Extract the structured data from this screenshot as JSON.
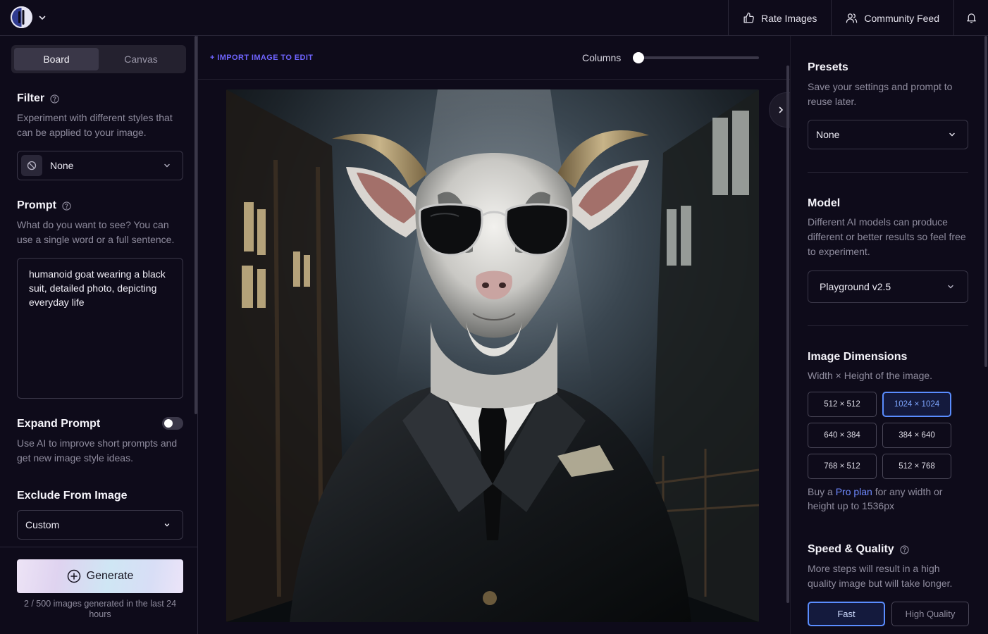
{
  "header": {
    "rate_label": "Rate Images",
    "feed_label": "Community Feed"
  },
  "left": {
    "tabs": [
      "Board",
      "Canvas"
    ],
    "active_tab": "Board",
    "filter": {
      "title": "Filter",
      "desc": "Experiment with different styles that can be applied to your image.",
      "value": "None"
    },
    "prompt": {
      "title": "Prompt",
      "desc": "What do you want to see? You can use a single word or a full sentence.",
      "value": "humanoid goat wearing a black suit, detailed photo, depicting everyday life"
    },
    "expand": {
      "title": "Expand Prompt",
      "desc": "Use AI to improve short prompts and get new image style ideas.",
      "enabled": false
    },
    "exclude": {
      "title": "Exclude From Image",
      "value": "Custom"
    },
    "generate_label": "Generate",
    "count_text": "2 / 500 images generated in the last 24 hours"
  },
  "center": {
    "import_label": "+ IMPORT IMAGE TO EDIT",
    "columns_label": "Columns",
    "columns_slider_fraction": 0.0,
    "image_alt": "humanoid goat wearing sunglasses and a black suit"
  },
  "right": {
    "presets": {
      "title": "Presets",
      "desc": "Save your settings and prompt to reuse later.",
      "value": "None"
    },
    "model": {
      "title": "Model",
      "desc": "Different AI models can produce different or better results so feel free to experiment.",
      "value": "Playground v2.5"
    },
    "dimensions": {
      "title": "Image Dimensions",
      "desc": "Width × Height of the image.",
      "options": [
        "512 × 512",
        "1024 × 1024",
        "640 × 384",
        "384 × 640",
        "768 × 512",
        "512 × 768"
      ],
      "selected": "1024 × 1024",
      "pro_prefix": "Buy a ",
      "pro_link": "Pro plan",
      "pro_suffix": " for any width or height up to 1536px"
    },
    "speed": {
      "title": "Speed & Quality",
      "desc": "More steps will result in a high quality image but will take longer.",
      "options": [
        "Fast",
        "High Quality"
      ],
      "selected": "Fast"
    }
  },
  "colors": {
    "background": "#0e0b1a",
    "panel": "#24212f",
    "border": "#3a3748",
    "accent": "#5a8dff",
    "link": "#6f64ff"
  }
}
